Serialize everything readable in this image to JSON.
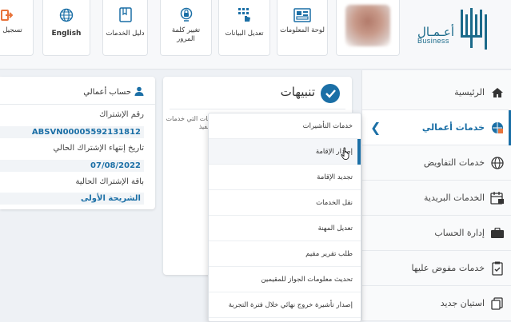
{
  "header": {
    "logo": {
      "arabic": "أعـمـال",
      "english": "Business"
    },
    "buttons": [
      {
        "key": "info_board",
        "label": "لوحة المعلومات",
        "icon": "dashboard-icon"
      },
      {
        "key": "edit_data",
        "label": "تعديل البيانات",
        "icon": "touch-edit-icon"
      },
      {
        "key": "change_password",
        "label": "تغيير كلمة المرور",
        "icon": "lock-change-icon"
      },
      {
        "key": "services_guide",
        "label": "دليل الخدمات",
        "icon": "book-icon"
      },
      {
        "key": "language",
        "label": "English",
        "icon": "globe-icon"
      },
      {
        "key": "logout",
        "label": "تسجيل الخ",
        "icon": "logout-icon"
      }
    ]
  },
  "sidebar": {
    "items": [
      {
        "label": "الرئيسية",
        "icon": "home-icon"
      },
      {
        "label": "خدمات أعمالي",
        "icon": "business-services-icon",
        "active": true
      },
      {
        "label": "خدمات التفاويض",
        "icon": "globe-icon"
      },
      {
        "label": "الخدمات البريدية",
        "icon": "calendar-mail-icon"
      },
      {
        "label": "إدارة الحساب",
        "icon": "briefcase-icon"
      },
      {
        "label": "خدمات مفوض عليها",
        "icon": "clipboard-check-icon"
      },
      {
        "label": "استيان جديد",
        "icon": "copy-icon"
      }
    ]
  },
  "notifications": {
    "title": "تنبيهات",
    "text": "مات التي خدمات تنفيذ"
  },
  "account": {
    "title": "حساب أعمالي",
    "subscription_label": "رقم الإشتراك",
    "subscription_value": "ABSVN00005592131812",
    "expiry_label": "تاريخ إنتهاء الإشتراك الحالي",
    "expiry_value": "07/08/2022",
    "package_label": "باقة الإشتراك الحالية",
    "package_value": "الشريحة الأولى"
  },
  "dropdown": {
    "items": [
      {
        "label": "خدمات التأشيرات"
      },
      {
        "label": "إصدار الإقامة",
        "hover": true
      },
      {
        "label": "تجديد الإقامة"
      },
      {
        "label": "نقل الخدمات"
      },
      {
        "label": "تعديل المهنة"
      },
      {
        "label": "طلب تقرير مقيم"
      },
      {
        "label": "تحديث معلومات الجواز للمقيمين"
      },
      {
        "label": "إصدار تأشيرة خروج نهائي خلال فترة التجربة"
      }
    ]
  },
  "colors": {
    "accent": "#1b6fa6",
    "orange": "#e8743b"
  }
}
